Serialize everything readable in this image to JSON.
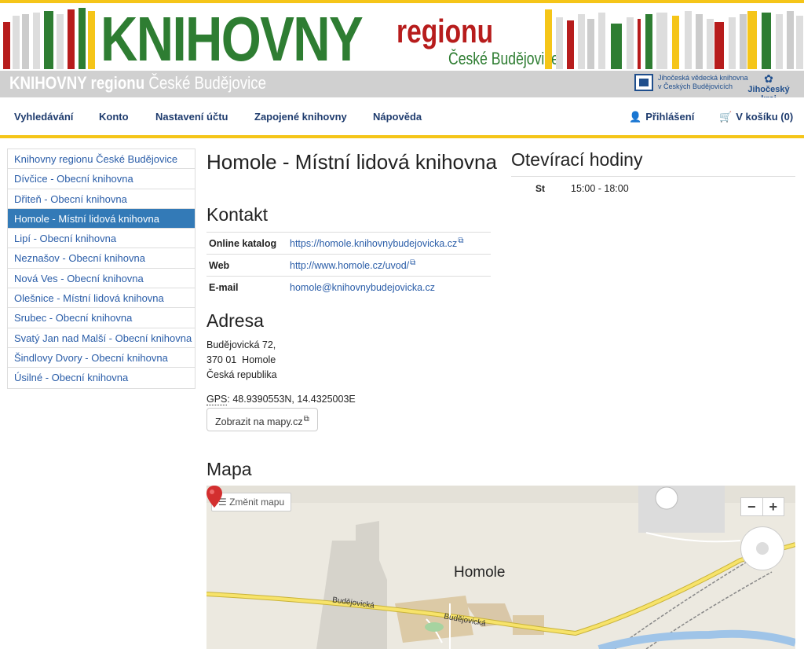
{
  "banner": {
    "title": "KNIHOVNY",
    "regionu": "regionu",
    "city": "České Budějovice"
  },
  "subheader": {
    "title_bold": "KNIHOVNY regionu",
    "title_thin": "České Budějovice",
    "jvk_line1": "Jihočeská vědecká knihovna",
    "jvk_line2": "v Českých Budějovicích",
    "kraj": "Jihočeský kraj"
  },
  "nav": {
    "items": [
      "Vyhledávání",
      "Konto",
      "Nastavení účtu",
      "Zapojené knihovny",
      "Nápověda"
    ],
    "login": "Přihlášení",
    "cart": "V košíku (0)"
  },
  "sidebar": {
    "items": [
      "Knihovny regionu České Budějovice",
      "Dívčice - Obecní knihovna",
      "Dřiteň - Obecní knihovna",
      "Homole - Místní lidová knihovna",
      "Lipí - Obecní knihovna",
      "Neznašov - Obecní knihovna",
      "Nová Ves - Obecní knihovna",
      "Olešnice - Místní lidová knihovna",
      "Srubec - Obecní knihovna",
      "Svatý Jan nad Malší - Obecní knihovna",
      "Šindlovy Dvory - Obecní knihovna",
      "Úsilné - Obecní knihovna"
    ],
    "active_index": 3
  },
  "main": {
    "title": "Homole - Místní lidová knihovna",
    "contact_heading": "Kontakt",
    "contact": [
      {
        "label": "Online katalog",
        "value": "https://homole.knihovnybudejovicka.cz"
      },
      {
        "label": "Web",
        "value": "http://www.homole.cz/uvod/"
      },
      {
        "label": "E-mail",
        "value": "homole@knihovnybudejovicka.cz"
      }
    ],
    "address_heading": "Adresa",
    "address_line1": "Budějovická 72,",
    "address_line2": "370 01  Homole",
    "address_line3": "Česká republika",
    "gps_label": "GPS",
    "gps_value": ": 48.9390553N, 14.4325003E",
    "map_button": "Zobrazit na mapy.cz",
    "map_heading": "Mapa"
  },
  "hours": {
    "heading": "Otevírací hodiny",
    "rows": [
      {
        "day": "St",
        "time": "15:00 - 18:00"
      }
    ]
  },
  "map": {
    "change_button": "Změnit mapu",
    "zoom_out": "−",
    "zoom_in": "+",
    "place_label": "Homole",
    "road_label": "Budějovická"
  },
  "colors": {
    "accent_yellow": "#f5c518",
    "brand_green": "#2e7d32",
    "brand_red": "#b71c1c",
    "link_blue": "#2a5da8",
    "active_blue": "#337ab7"
  }
}
